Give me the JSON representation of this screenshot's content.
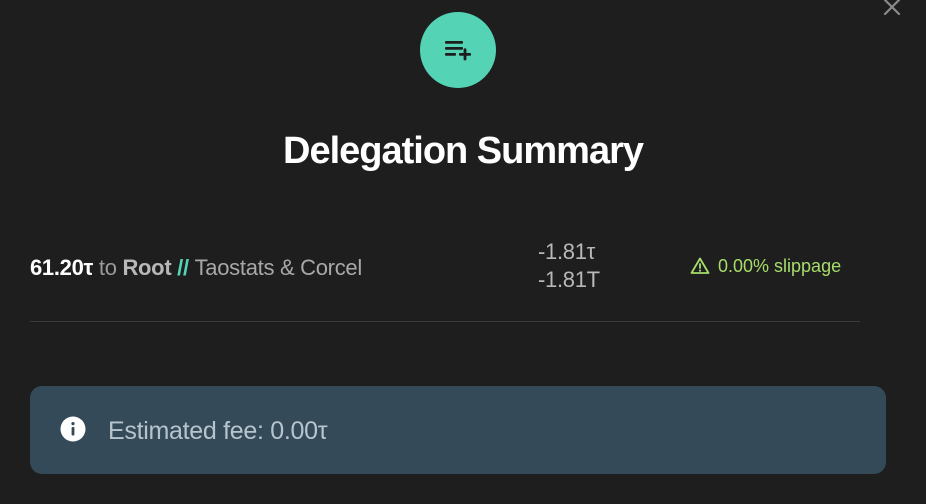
{
  "dialog": {
    "title": "Delegation Summary",
    "icon": "playlist-add-icon",
    "close_icon": "close-icon"
  },
  "delegation": {
    "amount": "61.20τ",
    "preposition": " to ",
    "subnet": "Root",
    "separator": " // ",
    "validator": "Taostats & Corcel",
    "change_primary": "-1.81τ",
    "change_secondary": "-1.81T",
    "slippage": "0.00% slippage"
  },
  "fee": {
    "text": "Estimated fee: 0.00τ"
  },
  "colors": {
    "accent": "#55d3b5",
    "background": "#1e1e1e",
    "fee_box": "#344a59",
    "slippage": "#a6dd6a"
  }
}
